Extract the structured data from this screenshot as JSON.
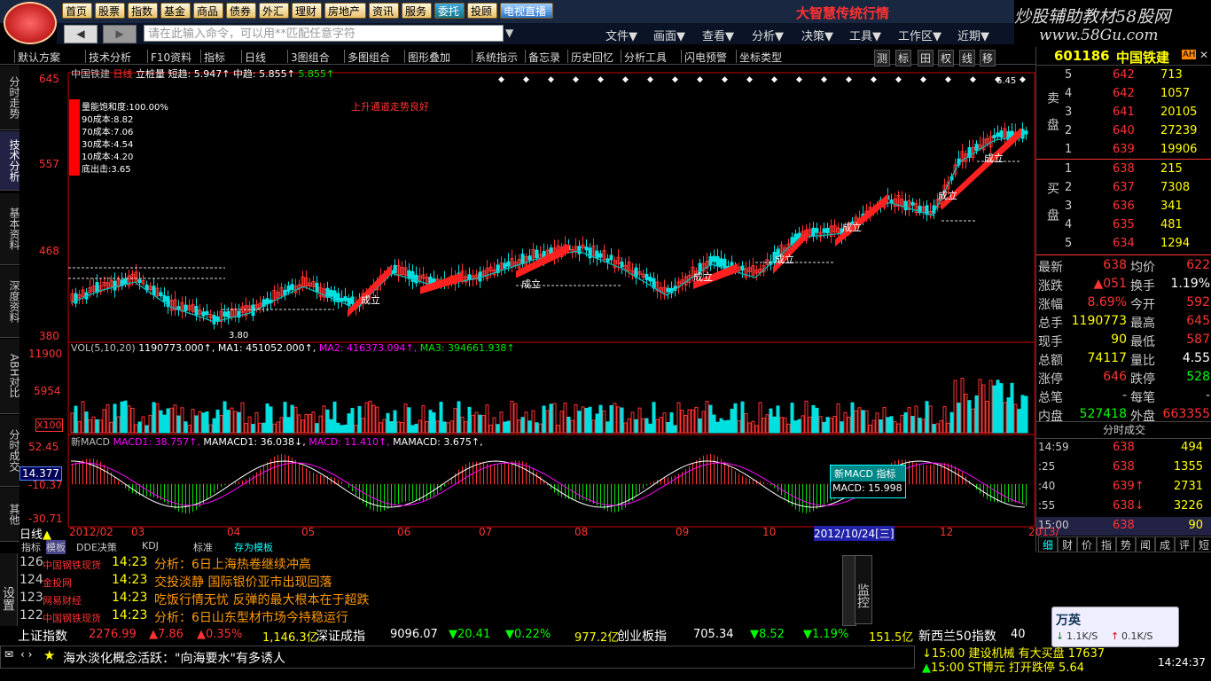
{
  "nav": [
    "首页",
    "股票",
    "指数",
    "基金",
    "商品",
    "债券",
    "外汇",
    "理财",
    "房地产",
    "资讯",
    "服务",
    "委托",
    "投顾",
    "电视直播"
  ],
  "banner_red": "大智慧传统行情",
  "banner_right": "炒股辅助教材58股网",
  "banner_url": "www.58Gu.com",
  "cmd_placeholder": "请在此输入命令，可以用**匹配任意字符",
  "menus": [
    "文件▼",
    "画面▼",
    "查看▼",
    "分析▼",
    "决策▼",
    "工具▼",
    "工作区▼",
    "近期▼"
  ],
  "toolbar": [
    "默认方案",
    "技术分析",
    "F10资料",
    "指标",
    "日线",
    "3图组合",
    "多图组合",
    "图形叠加",
    "系统指示",
    "备忘录",
    "历史回忆",
    "分析工具",
    "闪电预警",
    "坐标类型"
  ],
  "toolbar_right": [
    "测",
    "标",
    "田",
    "权",
    "线",
    "移"
  ],
  "left_tabs": [
    "分时走势",
    "技术分析",
    "基本资料",
    "深度资料",
    "ABH对比",
    "分时成交",
    "其他"
  ],
  "stock": {
    "code": "601186",
    "name": "中国铁建",
    "badge": "AH"
  },
  "chart_title": {
    "name": "中国铁建",
    "period": "日线",
    "ind": "立桩量",
    "short": "短趋: 5.947↑",
    "mid": "中趋: 5.855↑",
    "v3": "5.855↑"
  },
  "price_axis": [
    "645",
    "557",
    "468",
    "380"
  ],
  "cost_box": [
    "量能饱和度:100.00%",
    "90成本:8.82",
    "70成本:7.06",
    "30成本:4.54",
    "10成本:4.20",
    "底出击:3.65"
  ],
  "annotation": "上升通道走势良好",
  "labels": {
    "low": "3.80",
    "high": "6.45",
    "chengli": "成立"
  },
  "vol_title": [
    "VOL(5,10,20)",
    "1190773.000↑,",
    "MA1: 451052.000↑,",
    "MA2: 416373.094↑,",
    "MA3: 394661.938↑"
  ],
  "vol_axis": [
    "11900",
    "5954",
    "X100"
  ],
  "macd_title": [
    "新MACD",
    "MACD1: 38.757↑,",
    "MAMACD1: 36.038↓,",
    "MACD: 11.410↑,",
    "MAMACD: 3.675↑,"
  ],
  "macd_axis": [
    "52.45",
    "14.377",
    "-10.37",
    "-30.71"
  ],
  "macd_popup": {
    "title": "新MACD 指标",
    "value": "MACD:  15.998"
  },
  "x_axis": [
    "2012/02",
    "03",
    "04",
    "05",
    "06",
    "07",
    "08",
    "09",
    "10",
    "2012/10/24[三]",
    "12",
    "2013/"
  ],
  "period_label": "日线",
  "bottom_tabs": [
    "指标",
    "模板",
    "DDE决策",
    "KDJ",
    "标准",
    "存为模板"
  ],
  "orderbook": {
    "sell": [
      [
        "5",
        "642",
        "713"
      ],
      [
        "4",
        "642",
        "1057"
      ],
      [
        "3",
        "641",
        "20105"
      ],
      [
        "2",
        "640",
        "27239"
      ],
      [
        "1",
        "639",
        "19906"
      ]
    ],
    "buy": [
      [
        "1",
        "638",
        "215"
      ],
      [
        "2",
        "637",
        "7308"
      ],
      [
        "3",
        "636",
        "341"
      ],
      [
        "4",
        "635",
        "481"
      ],
      [
        "5",
        "634",
        "1294"
      ]
    ],
    "sell_label": "卖盘",
    "buy_label": "买盘"
  },
  "quote": [
    [
      "最新",
      "638",
      "均价",
      "622"
    ],
    [
      "涨跌",
      "▲051",
      "换手",
      "1.19%"
    ],
    [
      "涨幅",
      "8.69%",
      "今开",
      "592"
    ],
    [
      "总手",
      "1190773",
      "最高",
      "645"
    ],
    [
      "现手",
      "90",
      "最低",
      "587"
    ],
    [
      "总额",
      "74117",
      "量比",
      "4.55"
    ],
    [
      "涨停",
      "646",
      "跌停",
      "528"
    ],
    [
      "总笔",
      "-",
      "每笔",
      "-"
    ],
    [
      "内盘",
      "527418",
      "外盘",
      "663355"
    ]
  ],
  "ticks_title": "分时成交",
  "ticks": [
    [
      "14:59",
      "638",
      "494"
    ],
    [
      ":25",
      "638",
      "1355"
    ],
    [
      ":40",
      "639↑",
      "2731"
    ],
    [
      ":55",
      "638↓",
      "3226"
    ],
    [
      "15:00",
      "638",
      "90"
    ]
  ],
  "right_tabs": [
    "细",
    "财",
    "价",
    "指",
    "势",
    "闻",
    "成",
    "评",
    "短"
  ],
  "news": [
    {
      "no": "126",
      "src": "中国钢铁现货",
      "time": "14:23",
      "text": "分析：6日上海热卷继续冲高"
    },
    {
      "no": "124",
      "src": "金投网",
      "time": "14:23",
      "text": "交投淡静 国际银价亚市出现回落"
    },
    {
      "no": "123",
      "src": "网易财经",
      "time": "14:23",
      "text": "吃饭行情无忧 反弹的最大根本在于超跌"
    },
    {
      "no": "122",
      "src": "中国钢铁现货",
      "time": "14:23",
      "text": "分析：6日山东型材市场今持稳运行"
    }
  ],
  "news_side": [
    "设置"
  ],
  "monitor": "监控",
  "ticker": [
    {
      "name": "上证指数",
      "v": "2276.99",
      "c": "▲7.86",
      "p": "▲0.35%",
      "a": "1,146.3亿"
    },
    {
      "name": "深证成指",
      "v": "9096.07",
      "c": "▼20.41",
      "p": "▼0.22%",
      "a": "977.2亿"
    },
    {
      "name": "创业板指",
      "v": "705.34",
      "c": "▼8.52",
      "p": "▼1.19%",
      "a": "151.5亿"
    },
    {
      "name": "新西兰50指数",
      "v": "40",
      "c": "",
      "p": "",
      "a": ""
    }
  ],
  "marquee": "海水淡化概念活跃：\"向海要水\"有多诱人",
  "alerts": [
    "15:00 建设机械 有大买盘 17637",
    "15:00 ST博元 打开跌停 5.64"
  ],
  "ime": {
    "lang": "万英",
    "up": "1.1K/S",
    "down": "0.1K/S"
  },
  "clock": "14:24:37"
}
